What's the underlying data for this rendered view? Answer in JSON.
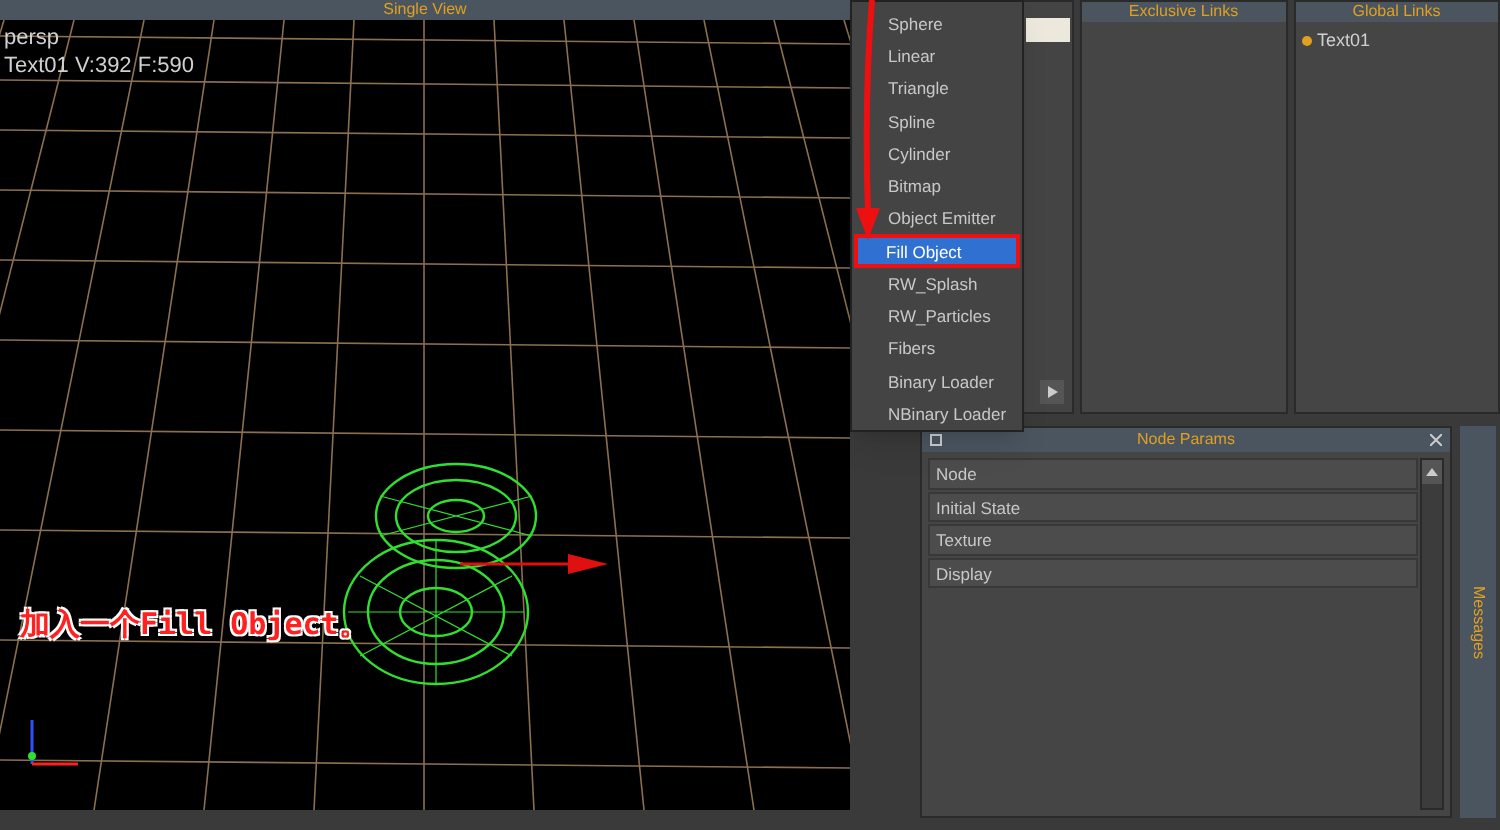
{
  "viewport": {
    "title": "Single View",
    "camera": "persp",
    "stats": "Text01 V:392 F:590",
    "caption": "加入一个Fill Object。"
  },
  "menu": {
    "items": [
      {
        "label": "Sphere",
        "selected": false
      },
      {
        "label": "Linear",
        "selected": false
      },
      {
        "label": "Triangle",
        "selected": false
      },
      {
        "label": "Spline",
        "selected": false
      },
      {
        "label": "Cylinder",
        "selected": false
      },
      {
        "label": "Bitmap",
        "selected": false
      },
      {
        "label": "Object Emitter",
        "selected": false
      },
      {
        "label": "Fill Object",
        "selected": true
      },
      {
        "label": "RW_Splash",
        "selected": false
      },
      {
        "label": "RW_Particles",
        "selected": false
      },
      {
        "label": "Fibers",
        "selected": false
      },
      {
        "label": "Binary Loader",
        "selected": false
      },
      {
        "label": "NBinary Loader",
        "selected": false
      }
    ]
  },
  "panels": [
    {
      "title": "Exclusive Links"
    },
    {
      "title": "Global Links",
      "items": [
        "Text01"
      ]
    }
  ],
  "node_params": {
    "title": "Node Params",
    "sections": [
      "Node",
      "Initial State",
      "Texture",
      "Display"
    ]
  },
  "messages": {
    "title": "Messages"
  }
}
